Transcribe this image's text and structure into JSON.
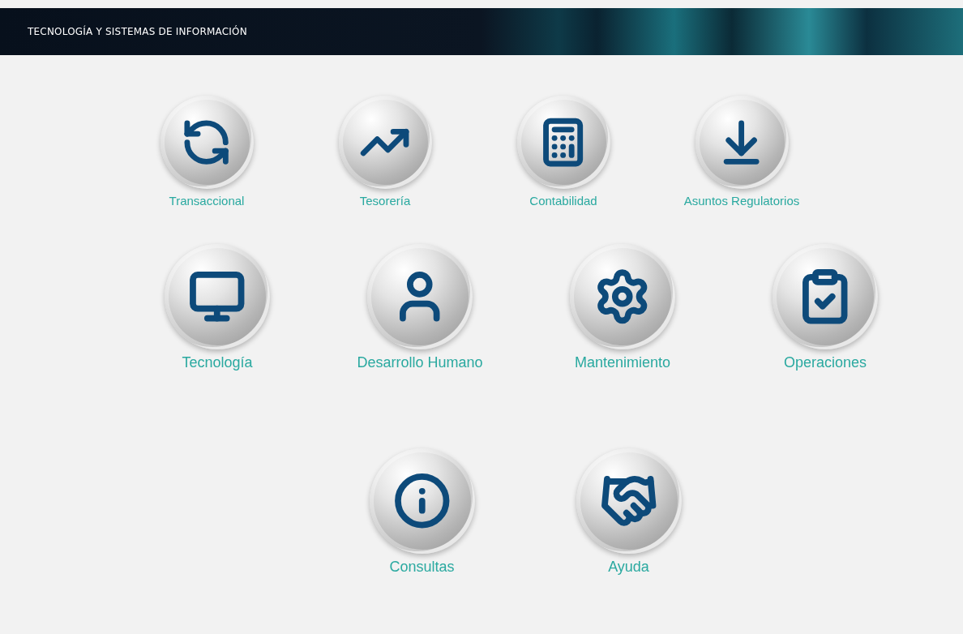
{
  "header": {
    "title": "TECNOLOGÍA Y SISTEMAS DE INFORMACIÓN"
  },
  "rows": [
    {
      "modules": [
        {
          "kind": "exchange",
          "label": "Transaccional"
        },
        {
          "kind": "growth",
          "label": "Tesorería"
        },
        {
          "kind": "calculator",
          "label": "Contabilidad"
        },
        {
          "kind": "download",
          "label": "Asuntos Regulatorios"
        }
      ]
    },
    {
      "modules": [
        {
          "kind": "monitor",
          "label": "Tecnología"
        },
        {
          "kind": "person",
          "label": "Desarrollo Humano"
        },
        {
          "kind": "gear",
          "label": "Mantenimiento"
        },
        {
          "kind": "clipboard",
          "label": "Operaciones"
        }
      ]
    },
    {
      "modules": [
        {
          "kind": "info",
          "label": "Consultas"
        },
        {
          "kind": "handshake",
          "label": "Ayuda"
        }
      ]
    }
  ]
}
